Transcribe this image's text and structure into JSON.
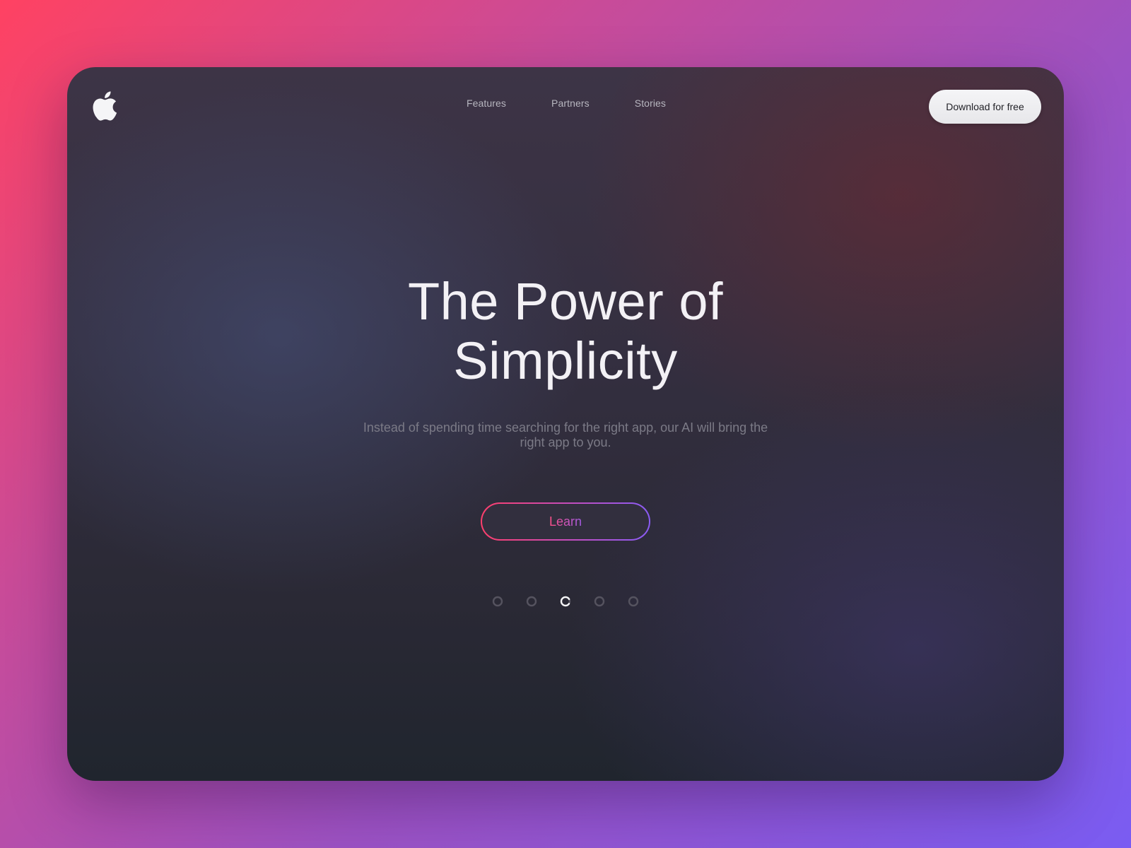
{
  "brand": {
    "logo_icon": "apple-logo-icon"
  },
  "nav": {
    "links": [
      {
        "label": "Features"
      },
      {
        "label": "Partners"
      },
      {
        "label": "Stories"
      }
    ],
    "cta_label": "Download for free"
  },
  "hero": {
    "title_line1": "The Power of",
    "title_line2": "Simplicity",
    "subtitle": "Instead of spending time searching for the right app, our AI will bring the right app to you.",
    "button_label": "Learn"
  },
  "carousel": {
    "total": 5,
    "active_index": 2,
    "dot_icon": "ring-icon"
  },
  "colors": {
    "accent_start": "#ff3f6c",
    "accent_end": "#8a5cf5",
    "page_gradient": [
      "#ff4262",
      "#c94b98",
      "#9c52c3",
      "#7a5cf2"
    ]
  }
}
